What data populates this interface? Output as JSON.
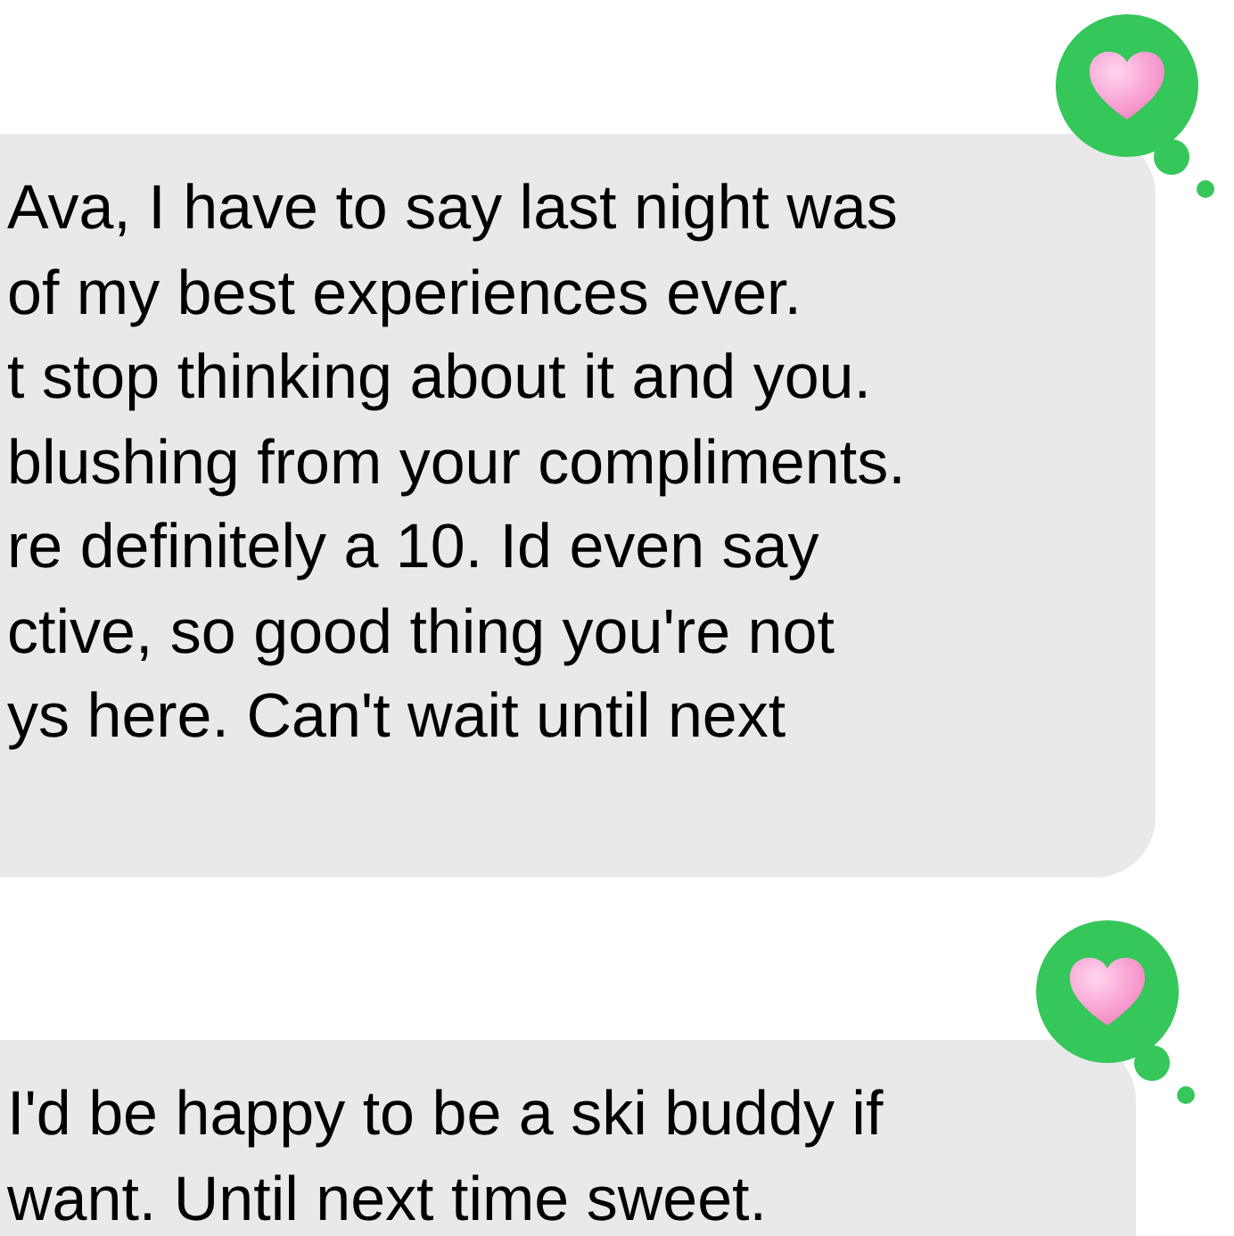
{
  "messages": [
    {
      "lines": [
        "Ava, I have to say last night was",
        "of my best experiences ever.",
        "t stop thinking about it and you.",
        "blushing from your compliments.",
        "re definitely a 10. Id even say",
        "ctive, so good thing you're not",
        "ys here. Can't wait until next"
      ],
      "reaction": {
        "kind": "heart"
      }
    },
    {
      "lines": [
        "I'd be happy to be a ski buddy if",
        "want. Until next time sweet."
      ],
      "reaction": {
        "kind": "heart"
      }
    }
  ]
}
